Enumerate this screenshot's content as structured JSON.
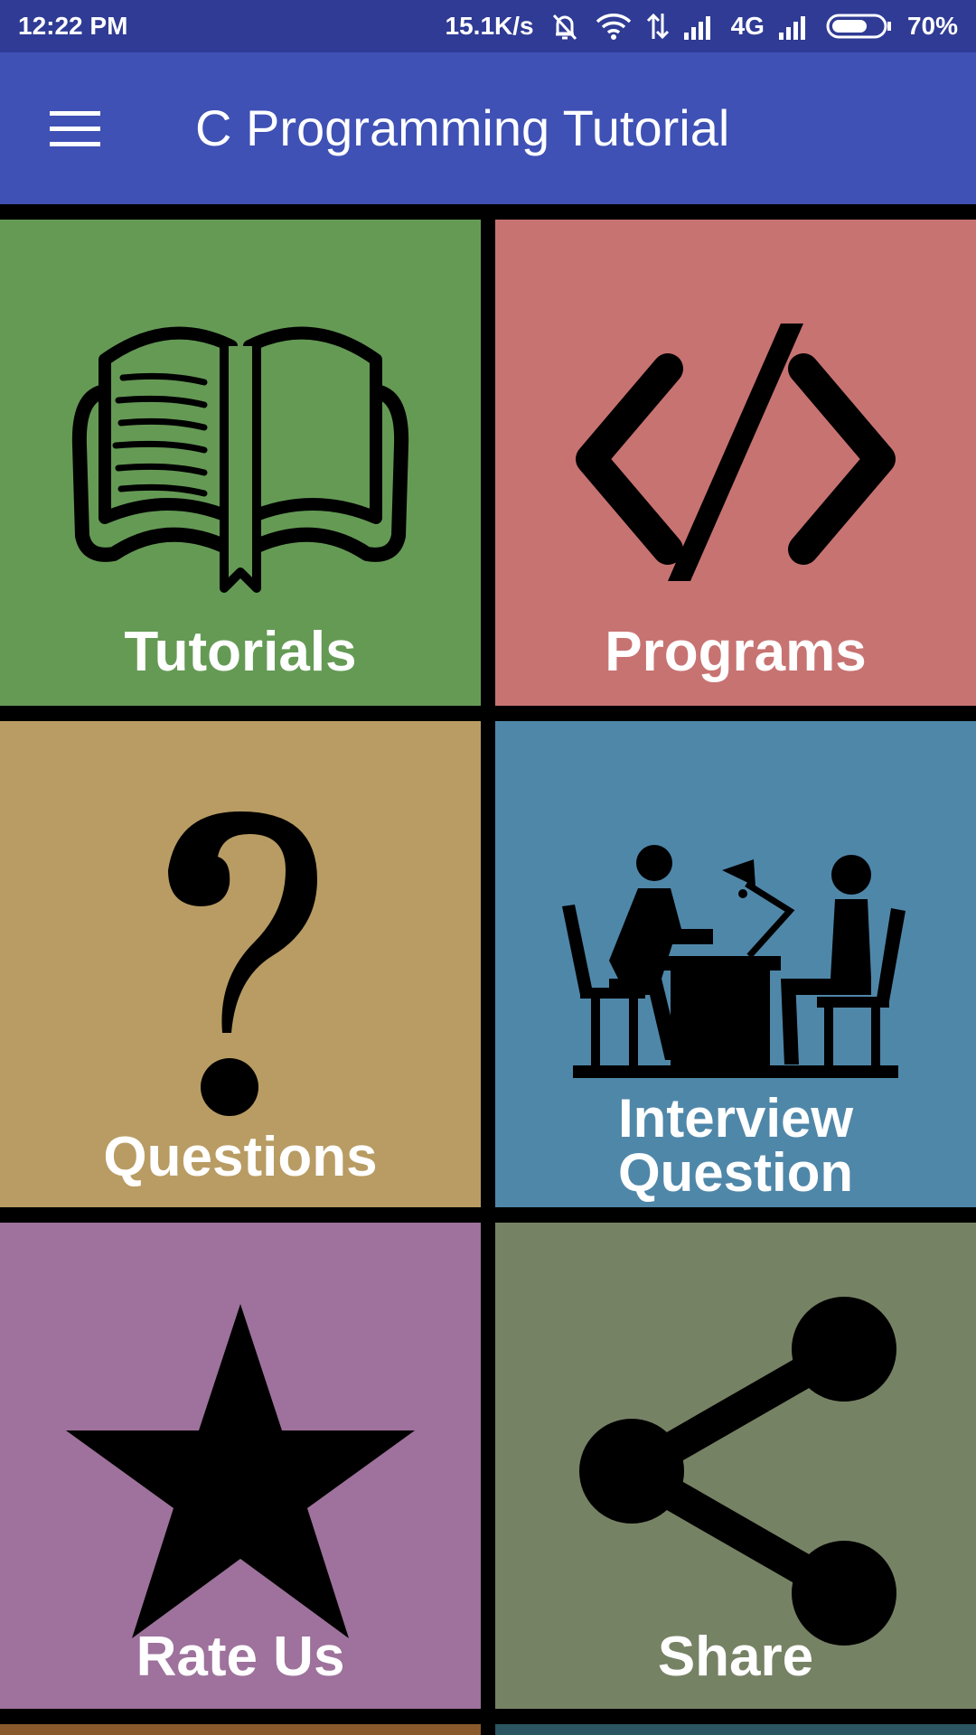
{
  "status_bar": {
    "time": "12:22 PM",
    "network_speed": "15.1K/s",
    "network_type": "4G",
    "battery_percent": "70%",
    "battery_level": 0.7,
    "icons": [
      "mute-icon",
      "wifi-icon",
      "data-transfer-icon",
      "signal-icon",
      "signal-icon",
      "battery-icon"
    ]
  },
  "app_bar": {
    "title": "C Programming Tutorial",
    "menu_icon": "hamburger-menu-icon"
  },
  "tiles": [
    {
      "label": "Tutorials",
      "icon": "book-icon",
      "color": "#659a55"
    },
    {
      "label": "Programs",
      "icon": "code-icon",
      "color": "#c77372"
    },
    {
      "label": "Questions",
      "icon": "question-mark-icon",
      "color": "#b89c63"
    },
    {
      "label_line1": "Interview",
      "label_line2": "Question",
      "icon": "interview-icon",
      "color": "#4f87a9"
    },
    {
      "label": "Rate Us",
      "icon": "star-icon",
      "color": "#9e729c"
    },
    {
      "label": "Share",
      "icon": "share-icon",
      "color": "#768264"
    }
  ],
  "colors": {
    "status_bar": "#2f3b94",
    "app_bar": "#3f51b5",
    "background": "#000000",
    "partial_tile_left": "#8a5a2c",
    "partial_tile_right": "#2b5561"
  }
}
